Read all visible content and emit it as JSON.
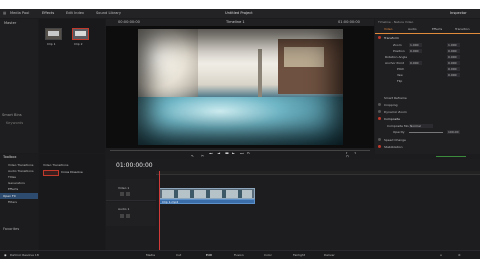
{
  "top_menu": {
    "media_pool": "Media Pool",
    "effects": "Effects",
    "edit_index": "Edit Index",
    "sound_library": "Sound Library",
    "project_title": "Untitled Project",
    "inspector": "Inspector"
  },
  "media": {
    "folder_label": "Master",
    "smart_bins": "Smart Bins",
    "keywords": "Keywords",
    "clips": [
      {
        "name": "Clip 1"
      },
      {
        "name": "Clip 2"
      }
    ]
  },
  "viewer": {
    "timeline_name": "Timeline 1",
    "timecode_left": "00:00:00:00",
    "timecode_right": "01:00:00:00",
    "zoom": "56%"
  },
  "inspector": {
    "header": "Timeline - Nature Video",
    "tabs": [
      "Video",
      "Audio",
      "Effects",
      "Transition"
    ],
    "sections": {
      "transform": "Transform",
      "zoom": "Zoom",
      "position": "Position",
      "rotation": "Rotation Angle",
      "anchor": "Anchor Point",
      "pitch": "Pitch",
      "yaw": "Yaw",
      "flip": "Flip",
      "smart_reframe": "Smart Reframe",
      "cropping": "Cropping",
      "dynamic_zoom": "Dynamic Zoom",
      "composite": "Composite",
      "composite_mode": "Composite Mode",
      "composite_mode_value": "Normal",
      "opacity": "Opacity",
      "opacity_value": "100.00",
      "speed_change": "Speed Change",
      "stabilization": "Stabilization"
    },
    "values": {
      "zoom_x": "1.000",
      "zoom_y": "1.000",
      "pos_x": "0.000",
      "pos_y": "0.000",
      "rotation": "0.000",
      "anchor_x": "0.000",
      "anchor_y": "0.000",
      "pitch": "0.000",
      "yaw": "0.000"
    }
  },
  "effects_panel": {
    "title": "Toolbox",
    "items": [
      "Video Transitions",
      "Audio Transitions",
      "Titles",
      "Generators",
      "Effects",
      "Open FX",
      "Filters",
      "Audio FX"
    ],
    "selected": "Open FX",
    "list_header": "Video Transitions",
    "list_item": "Cross Dissolve",
    "favorites": "Favorites"
  },
  "timeline": {
    "timecode": "01:00:00:00",
    "tracks": [
      {
        "name": "Video 1",
        "id": "V1"
      },
      {
        "name": "Audio 1",
        "id": "A1"
      }
    ],
    "clip_label": "Clip 1.mp4"
  },
  "bottom": {
    "app_name": "DaVinci Resolve 18",
    "pages": [
      "Media",
      "Cut",
      "Edit",
      "Fusion",
      "Color",
      "Fairlight",
      "Deliver"
    ],
    "active_page": "Edit"
  },
  "colors": {
    "accent_orange": "#e08a3c",
    "playhead_red": "#d23a3a",
    "clip_blue": "#3b6ea8",
    "background": "#1b1b1d"
  }
}
